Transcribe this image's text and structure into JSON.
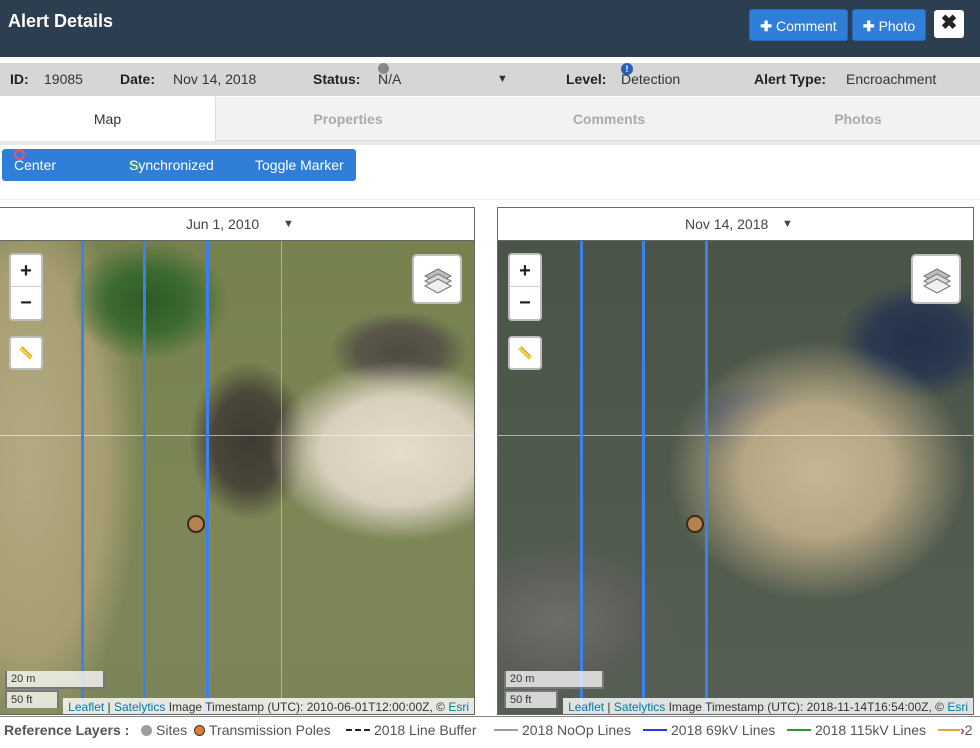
{
  "header": {
    "title": "Alert Details",
    "comment_label": "Comment",
    "photo_label": "Photo",
    "close_label": "✖"
  },
  "info": {
    "id_label": "ID:",
    "id_value": "19085",
    "date_label": "Date:",
    "date_value": "Nov 14, 2018",
    "status_label": "Status:",
    "status_value": "N/A",
    "level_label": "Level:",
    "level_value": "Detection",
    "alert_type_label": "Alert Type:",
    "alert_type_value": "Encroachment"
  },
  "tabs": [
    {
      "label": "Map",
      "active": true
    },
    {
      "label": "Properties",
      "active": false
    },
    {
      "label": "Comments",
      "active": false
    },
    {
      "label": "Photos",
      "active": false
    }
  ],
  "toolbar": {
    "center_alert": "Center Alert",
    "synchronized": "Synchronized",
    "toggle_marker": "Toggle Marker"
  },
  "maps": {
    "left": {
      "date": "Jun 1, 2010",
      "scale_m": "20 m",
      "scale_ft": "50 ft",
      "attrib_leaflet": "Leaflet",
      "attrib_satelytics": "Satelytics",
      "attrib_text": " Image Timestamp (UTC): 2010-06-01T12:00:00Z, © ",
      "attrib_esri": "Esri"
    },
    "right": {
      "date": "Nov 14, 2018",
      "scale_m": "20 m",
      "scale_ft": "50 ft",
      "attrib_leaflet": "Leaflet",
      "attrib_satelytics": "Satelytics",
      "attrib_text": " Image Timestamp (UTC): 2018-11-14T16:54:00Z, © ",
      "attrib_esri": "Esri"
    },
    "zoom_in": "+",
    "zoom_out": "−"
  },
  "legend": {
    "title": "Reference Layers :",
    "items": [
      {
        "label": "Sites",
        "color": "#9e9e9e",
        "kind": "dot"
      },
      {
        "label": "Transmission Poles",
        "color": "#e07b39",
        "kind": "dot"
      },
      {
        "label": "2018 Line Buffer",
        "color": "#222222",
        "kind": "dash"
      },
      {
        "label": "2018 NoOp Lines",
        "color": "#9e9e9e",
        "kind": "line"
      },
      {
        "label": "2018 69kV Lines",
        "color": "#1f3de0",
        "kind": "line"
      },
      {
        "label": "2018 115kV Lines",
        "color": "#2c9b2c",
        "kind": "line"
      },
      {
        "label": "2",
        "color": "#e8a33a",
        "kind": "arrow"
      }
    ]
  },
  "colors": {
    "header_bg": "#2c3e50",
    "accent": "#2f7ed8",
    "line_69kv": "#3b82f0",
    "pole": "#b5834e"
  }
}
